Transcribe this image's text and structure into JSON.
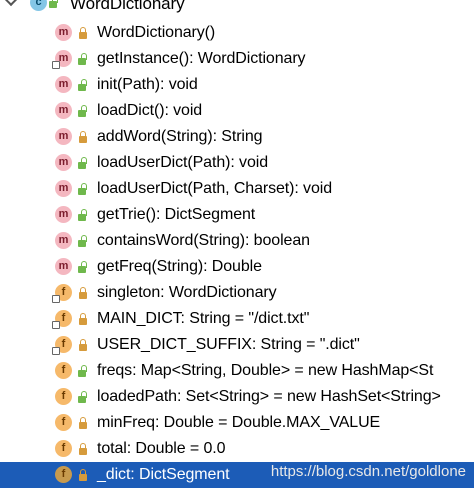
{
  "class_node": {
    "name": "WordDictionary",
    "badge": "c"
  },
  "members": [
    {
      "name": "WordDictionary()",
      "kind": "m",
      "visibility": "private",
      "static": false
    },
    {
      "name": "getInstance(): WordDictionary",
      "kind": "m",
      "visibility": "public",
      "static": true
    },
    {
      "name": "init(Path): void",
      "kind": "m",
      "visibility": "public",
      "static": false
    },
    {
      "name": "loadDict(): void",
      "kind": "m",
      "visibility": "public",
      "static": false
    },
    {
      "name": "addWord(String): String",
      "kind": "m",
      "visibility": "private",
      "static": false
    },
    {
      "name": "loadUserDict(Path): void",
      "kind": "m",
      "visibility": "public",
      "static": false
    },
    {
      "name": "loadUserDict(Path, Charset): void",
      "kind": "m",
      "visibility": "public",
      "static": false
    },
    {
      "name": "getTrie(): DictSegment",
      "kind": "m",
      "visibility": "public",
      "static": false
    },
    {
      "name": "containsWord(String): boolean",
      "kind": "m",
      "visibility": "public",
      "static": false
    },
    {
      "name": "getFreq(String): Double",
      "kind": "m",
      "visibility": "public",
      "static": false
    },
    {
      "name": "singleton: WordDictionary",
      "kind": "f",
      "visibility": "private",
      "static": true
    },
    {
      "name": "MAIN_DICT: String = \"/dict.txt\"",
      "kind": "f",
      "visibility": "private",
      "static": true
    },
    {
      "name": "USER_DICT_SUFFIX: String = \".dict\"",
      "kind": "f",
      "visibility": "private",
      "static": true
    },
    {
      "name": "freqs: Map<String, Double> = new HashMap<St",
      "kind": "f",
      "visibility": "public",
      "static": false
    },
    {
      "name": "loadedPath: Set<String> = new HashSet<String>",
      "kind": "f",
      "visibility": "public",
      "static": false
    },
    {
      "name": "minFreq: Double = Double.MAX_VALUE",
      "kind": "f",
      "visibility": "private",
      "static": false
    },
    {
      "name": "total: Double = 0.0",
      "kind": "f",
      "visibility": "private",
      "static": false
    },
    {
      "name": "_dict: DictSegment",
      "kind": "f",
      "visibility": "private",
      "static": false,
      "selected": true
    }
  ],
  "watermark": "https://blog.csdn.net/goldlone",
  "colors": {
    "selection": "#1c5cb7",
    "method_badge": "#f4b7c0",
    "field_badge": "#f6b96a",
    "class_badge": "#84c6e6"
  }
}
